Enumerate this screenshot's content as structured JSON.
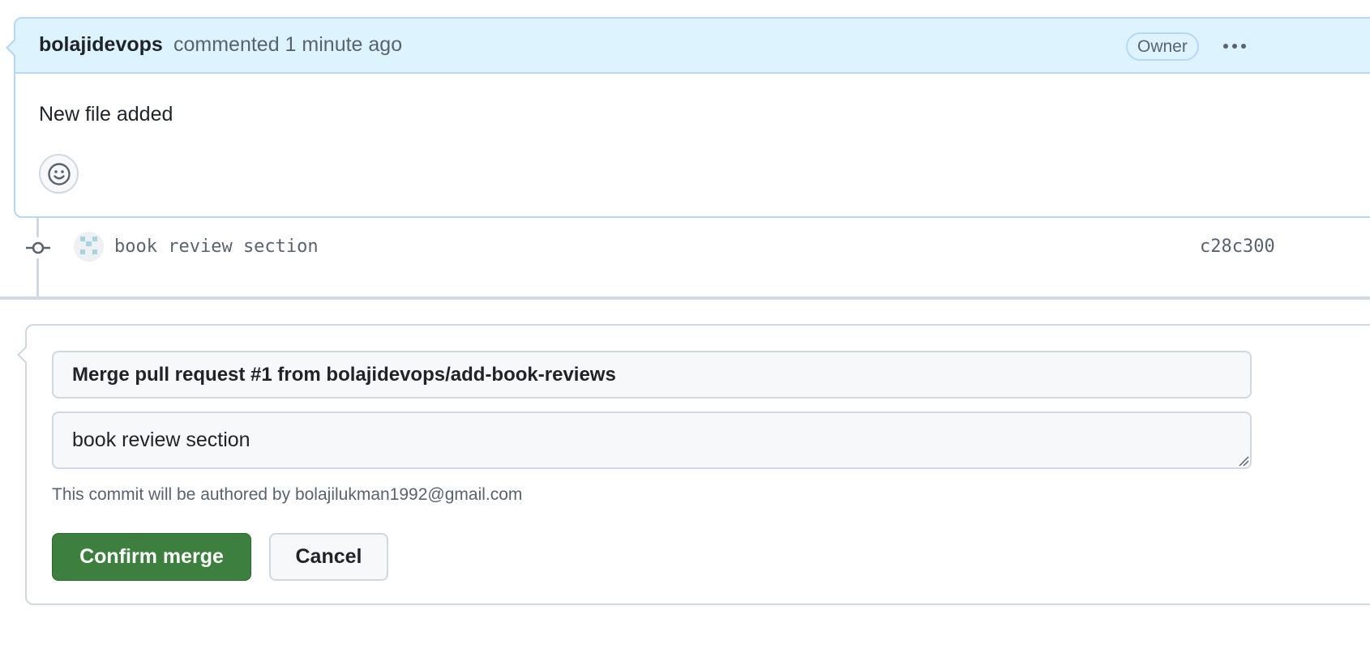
{
  "comment": {
    "author": "bolajidevops",
    "meta": "commented 1 minute ago",
    "badge": "Owner",
    "body": "New file added",
    "menu_icon": "kebab-horizontal-icon",
    "reaction_icon": "smiley-icon"
  },
  "commit": {
    "icon": "git-commit-icon",
    "message": "book review section",
    "sha": "c28c300"
  },
  "merge": {
    "title": "Merge pull request #1 from bolajidevops/add-book-reviews",
    "message": "book review section",
    "author_note": "This commit will be authored by bolajilukman1992@gmail.com",
    "confirm_label": "Confirm merge",
    "cancel_label": "Cancel"
  },
  "colors": {
    "header_bg": "#ddf4ff",
    "header_border": "#b6d7f5",
    "confirm_bg": "#3d7f3e",
    "muted_text": "#59636e",
    "border": "#d1d9e0"
  }
}
